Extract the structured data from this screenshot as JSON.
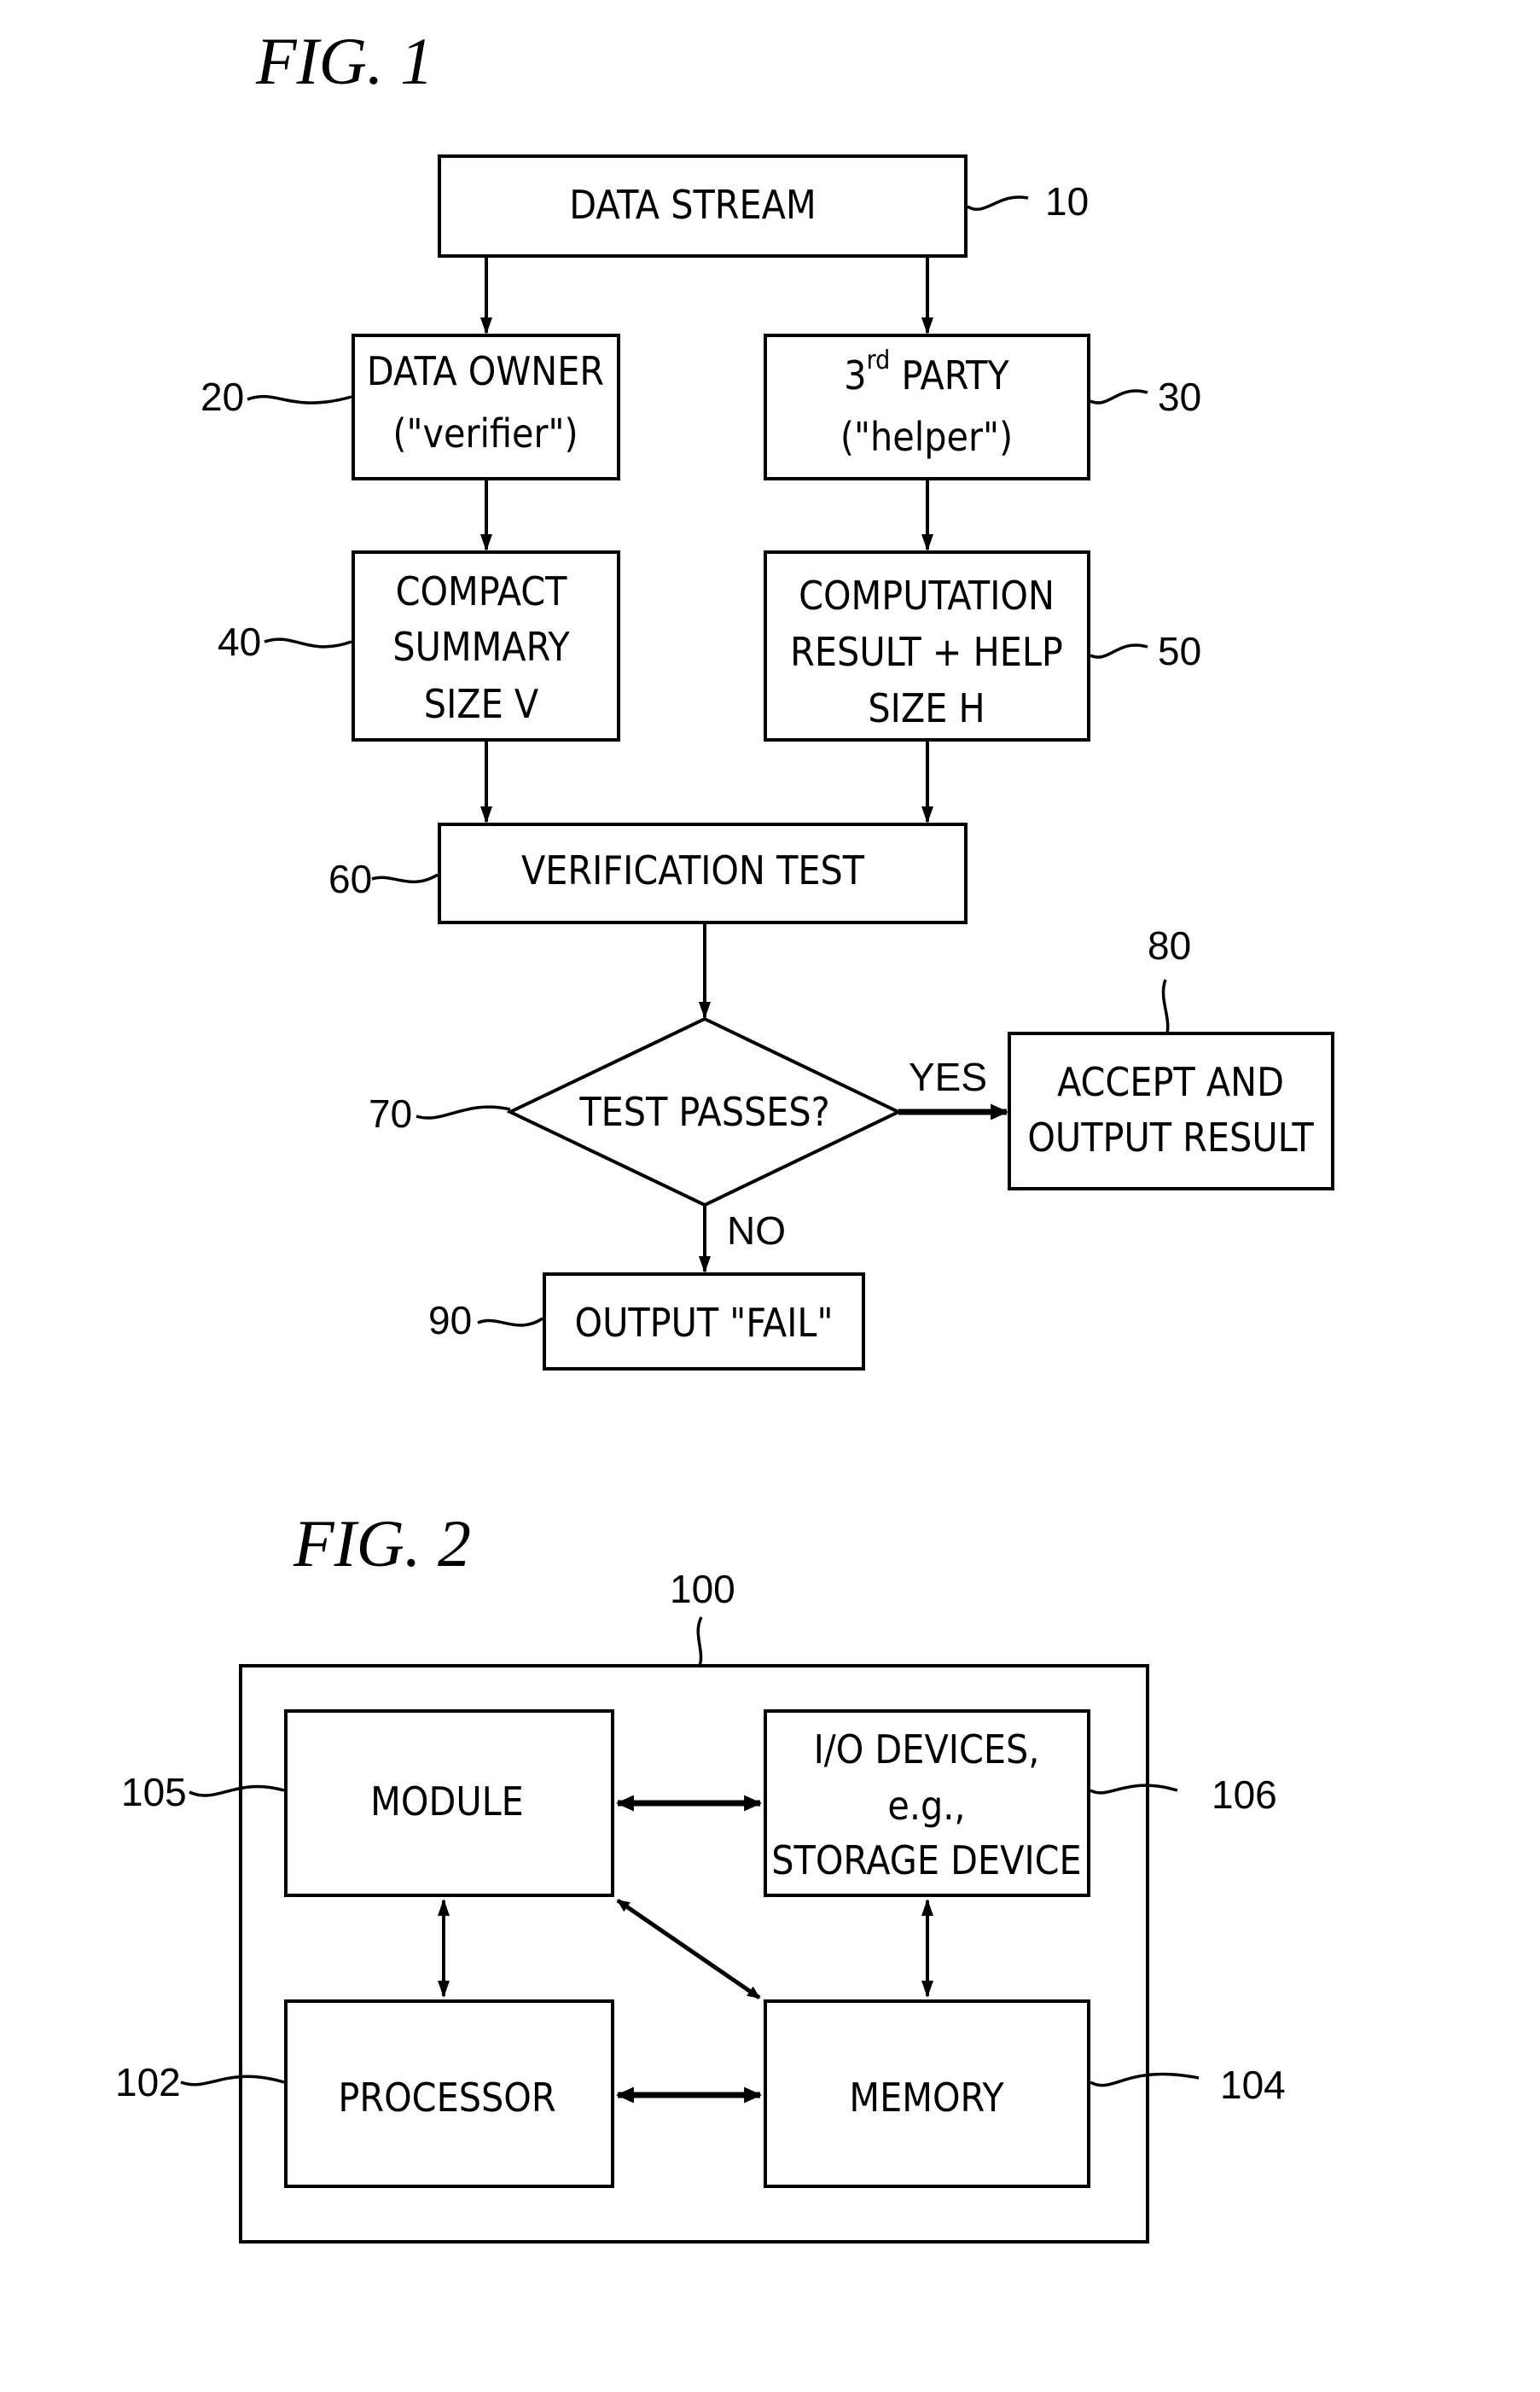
{
  "fig1": {
    "title": "FIG. 1",
    "nodes": {
      "data_stream": {
        "ref": "10",
        "lines": [
          "DATA STREAM"
        ]
      },
      "data_owner": {
        "ref": "20",
        "lines": [
          "DATA OWNER",
          "(\"verifier\")"
        ]
      },
      "third_party": {
        "ref": "30",
        "lines": [
          "3rd PARTY",
          "(\"helper\")"
        ],
        "line1_base": "3",
        "line1_sup": "rd",
        "line1_rest": " PARTY"
      },
      "compact_summary": {
        "ref": "40",
        "lines": [
          "COMPACT",
          "SUMMARY",
          "SIZE V"
        ]
      },
      "computation_result": {
        "ref": "50",
        "lines": [
          "COMPUTATION",
          "RESULT + HELP",
          "SIZE H"
        ]
      },
      "verification_test": {
        "ref": "60",
        "lines": [
          "VERIFICATION TEST"
        ]
      },
      "test_passes": {
        "ref": "70",
        "lines": [
          "TEST PASSES?"
        ]
      },
      "accept_output": {
        "ref": "80",
        "lines": [
          "ACCEPT AND",
          "OUTPUT RESULT"
        ]
      },
      "output_fail": {
        "ref": "90",
        "lines": [
          "OUTPUT \"FAIL\""
        ]
      }
    },
    "edge_labels": {
      "yes": "YES",
      "no": "NO"
    }
  },
  "fig2": {
    "title": "FIG. 2",
    "container_ref": "100",
    "nodes": {
      "module": {
        "ref": "105",
        "lines": [
          "MODULE"
        ]
      },
      "io_devices": {
        "ref": "106",
        "lines": [
          "I/O DEVICES,",
          "e.g.,",
          "STORAGE DEVICE"
        ]
      },
      "processor": {
        "ref": "102",
        "lines": [
          "PROCESSOR"
        ]
      },
      "memory": {
        "ref": "104",
        "lines": [
          "MEMORY"
        ]
      }
    }
  }
}
